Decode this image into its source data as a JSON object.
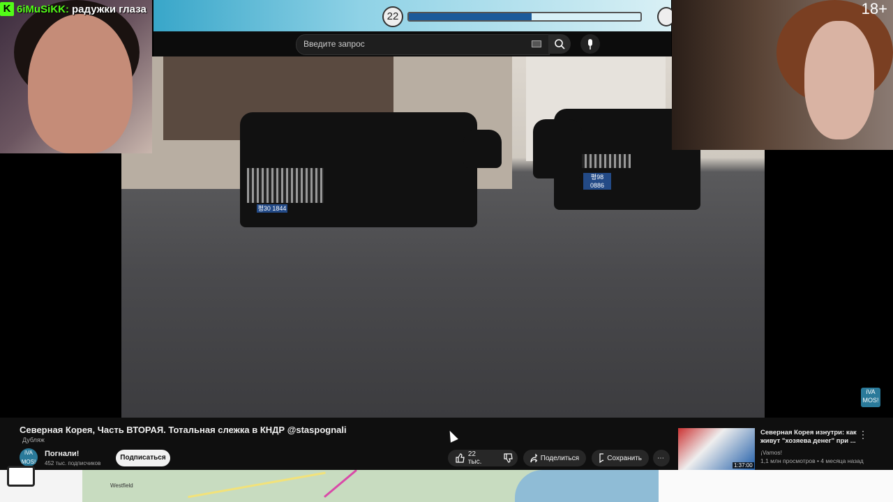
{
  "top_bar": {
    "level": "22",
    "progress_fraction": 0.53
  },
  "search": {
    "placeholder": "Введите запрос"
  },
  "chat_overlay": {
    "user": "6iMuSiKK:",
    "message": "радужки глаза"
  },
  "webcam_right": {
    "age_label": "18+"
  },
  "video": {
    "title": "Северная Корея, Часть ВТОРАЯ. Тотальная слежка в КНДР @staspognali",
    "dub_label": "Дубляж",
    "channel_name": "Погнали!",
    "subscribers": "452 тыс. подписчиков",
    "subscribe_label": "Подписаться",
    "likes": "22 тыс.",
    "share_label": "Поделиться",
    "save_label": "Сохранить",
    "plates": [
      "평30 1844",
      "평98 0886"
    ],
    "channel_logo_text": "iVA MOS!"
  },
  "recommended": {
    "title": "Северная Корея изнутри: как живут \"хозяева денег\" при ...",
    "channel": "¡Vamos!",
    "meta": "1,1 млн просмотров • 4 месяца назад",
    "duration": "1:37:00"
  },
  "map": {
    "label": "Westfield"
  }
}
